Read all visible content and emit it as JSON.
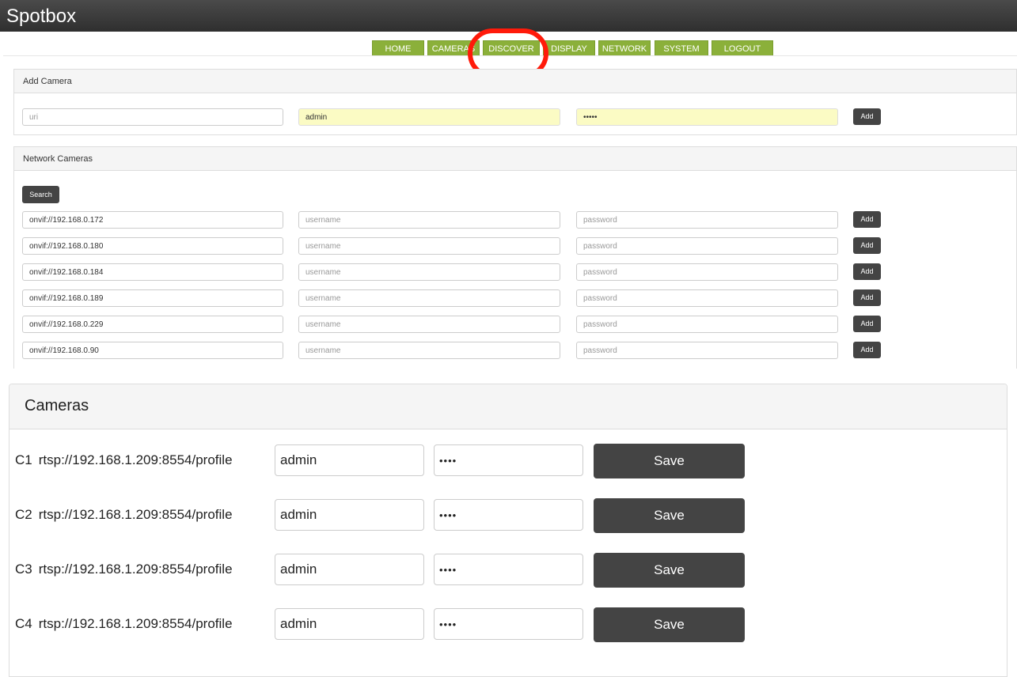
{
  "app": {
    "title": "Spotbox"
  },
  "nav": {
    "tabs": [
      "HOME",
      "CAMERAS",
      "DISCOVER",
      "DISPLAY",
      "NETWORK",
      "SYSTEM",
      "LOGOUT"
    ],
    "highlighted": "DISCOVER",
    "tab_color": "#8bb03a",
    "highlight_color": "#ff1a0a"
  },
  "add_camera": {
    "title": "Add Camera",
    "uri_placeholder": "uri",
    "username_value": "admin",
    "password_value": "•••••",
    "add_label": "Add"
  },
  "network_cameras": {
    "title": "Network Cameras",
    "search_label": "Search",
    "username_placeholder": "username",
    "password_placeholder": "password",
    "add_label": "Add",
    "rows": [
      "onvif://192.168.0.172",
      "onvif://192.168.0.180",
      "onvif://192.168.0.184",
      "onvif://192.168.0.189",
      "onvif://192.168.0.229",
      "onvif://192.168.0.90"
    ]
  },
  "cameras": {
    "title": "Cameras",
    "save_label": "Save",
    "rows": [
      {
        "id": "C1",
        "uri": "rtsp://192.168.1.209:8554/profile",
        "username": "admin",
        "password": "••••"
      },
      {
        "id": "C2",
        "uri": "rtsp://192.168.1.209:8554/profile",
        "username": "admin",
        "password": "••••"
      },
      {
        "id": "C3",
        "uri": "rtsp://192.168.1.209:8554/profile",
        "username": "admin",
        "password": "••••"
      },
      {
        "id": "C4",
        "uri": "rtsp://192.168.1.209:8554/profile",
        "username": "admin",
        "password": "••••"
      }
    ]
  }
}
